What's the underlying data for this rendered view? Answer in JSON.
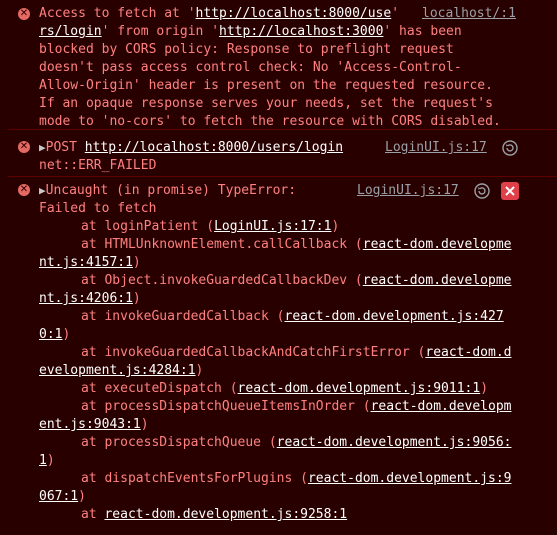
{
  "messages": {
    "cors": {
      "lines": [
        "Access to fetch at '",
        "http://localhost:8000/use",
        "' ",
        "rs/login",
        "' from origin '",
        "http://localhost:3000",
        "' has been",
        "blocked by CORS policy: Response to preflight request",
        "doesn't pass access control check: No 'Access-Control-",
        "Allow-Origin' header is present on the requested resource.",
        "If an opaque response serves your needs, set the request's",
        "mode to 'no-cors' to fetch the resource with CORS disabled."
      ],
      "source": "localhost/:1"
    },
    "post": {
      "method": "POST",
      "url": "http://localhost:8000/users/login",
      "status": "net::ERR_FAILED",
      "source": "LoginUI.js:17"
    },
    "uncaught": {
      "title": "Uncaught (in promise) TypeError:",
      "message": "Failed to fetch",
      "source": "LoginUI.js:17",
      "stack": [
        {
          "pre": "at loginPatient (",
          "link": "LoginUI.js:17:1",
          "post": ")"
        },
        {
          "pre": "at HTMLUnknownElement.callCallback (",
          "link": "react-dom.developme",
          "post": ""
        },
        {
          "pre": "",
          "link": "nt.js:4157:1",
          "post": ")"
        },
        {
          "pre": "at Object.invokeGuardedCallbackDev (",
          "link": "react-dom.developme",
          "post": ""
        },
        {
          "pre": "",
          "link": "nt.js:4206:1",
          "post": ")"
        },
        {
          "pre": "at invokeGuardedCallback (",
          "link": "react-dom.development.js:427",
          "post": ""
        },
        {
          "pre": "",
          "link": "0:1",
          "post": ")"
        },
        {
          "pre": "at invokeGuardedCallbackAndCatchFirstError (",
          "link": "react-dom.d",
          "post": ""
        },
        {
          "pre": "",
          "link": "evelopment.js:4284:1",
          "post": ")"
        },
        {
          "pre": "at executeDispatch (",
          "link": "react-dom.development.js:9011:1",
          "post": ")"
        },
        {
          "pre": "at processDispatchQueueItemsInOrder (",
          "link": "react-dom.developm",
          "post": ""
        },
        {
          "pre": "",
          "link": "ent.js:9043:1",
          "post": ")"
        },
        {
          "pre": "at processDispatchQueue (",
          "link": "react-dom.development.js:9056:",
          "post": ""
        },
        {
          "pre": "",
          "link": "1",
          "post": ")"
        },
        {
          "pre": "at dispatchEventsForPlugins (",
          "link": "react-dom.development.js:9",
          "post": ""
        },
        {
          "pre": "",
          "link": "067:1",
          "post": ")"
        },
        {
          "pre": "at ",
          "link": "react-dom.development.js:9258:1",
          "post": ""
        }
      ]
    }
  },
  "icons": {
    "error": "error-circle-icon",
    "reload": "reload-icon",
    "close": "close-x-icon"
  },
  "colors": {
    "background": "#290000",
    "text": "#ff8080",
    "link": "#ffffff",
    "source": "#9aa0a6",
    "error_icon": "#e46962",
    "close_button": "#e0404a"
  }
}
